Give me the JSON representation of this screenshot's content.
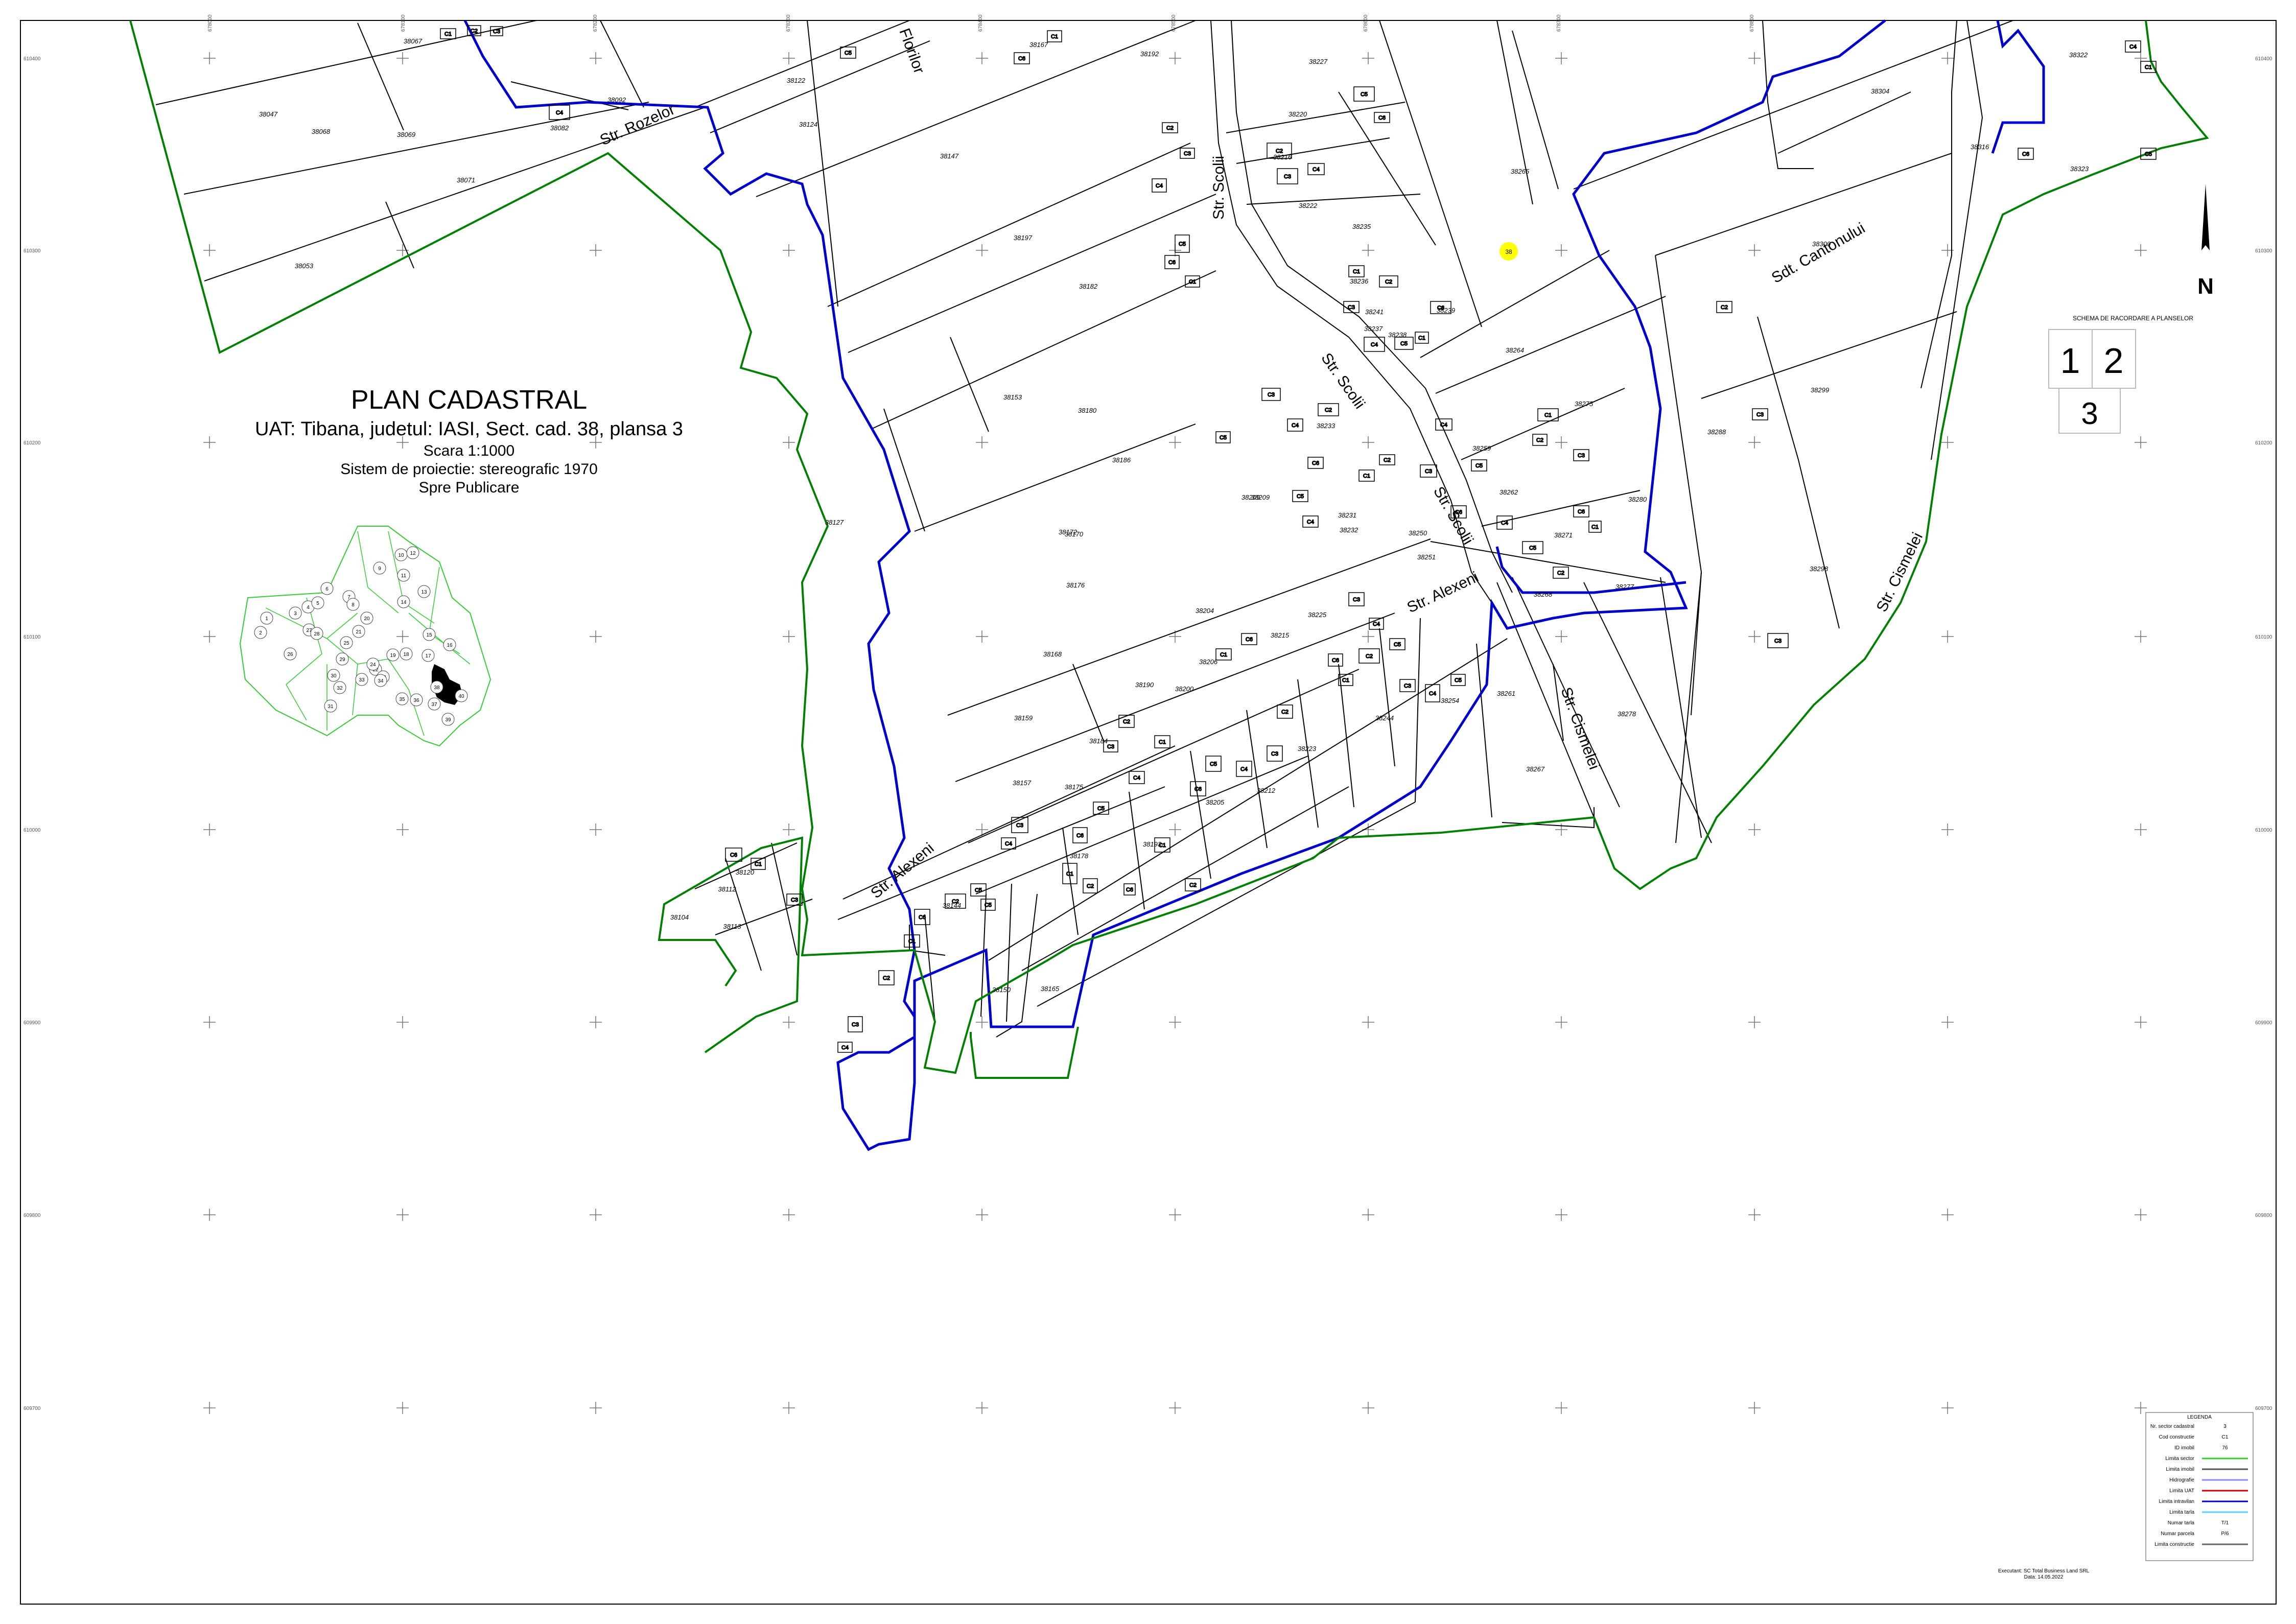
{
  "title": {
    "main": "PLAN CADASTRAL",
    "uat": "UAT: Tibana, judetul: IASI, Sect. cad. 38, plansa 3",
    "scale": "Scara 1:1000",
    "projection": "Sistem de proiectie: stereografic 1970",
    "purpose": "Spre Publicare"
  },
  "north_label": "N",
  "sector_marker": "38",
  "colors": {
    "parcel_line": "#000000",
    "intravilan": "#0000cc",
    "sector_boundary": "#008000",
    "overview_green": "#33cc33",
    "sector_marker": "#ffff00"
  },
  "streets": [
    {
      "label": "Str. Rozelor"
    },
    {
      "label": "Florilor"
    },
    {
      "label": "Str. Scolii"
    },
    {
      "label": "Str. Scolii"
    },
    {
      "label": "Str. Scolii"
    },
    {
      "label": "Str. Alexeni"
    },
    {
      "label": "Str. Alexeni"
    },
    {
      "label": "Str. Cismelei"
    },
    {
      "label": "Sdt. Cantonului"
    },
    {
      "label": "Str. Cismelei"
    }
  ],
  "parcels": [
    "38067",
    "38047",
    "38068",
    "38069",
    "38092",
    "38082",
    "38071",
    "38053",
    "38122",
    "38124",
    "38147",
    "38167",
    "38192",
    "38197",
    "38182",
    "38153",
    "38180",
    "38186",
    "38227",
    "38220",
    "38216",
    "38222",
    "38235",
    "38236",
    "38237",
    "38241",
    "38238",
    "38239",
    "38265",
    "38264",
    "38275",
    "38259",
    "38262",
    "38271",
    "38277",
    "38268",
    "38250",
    "38231",
    "38232",
    "38251",
    "38209",
    "38204",
    "38215",
    "38225",
    "38170",
    "38176",
    "38159",
    "38157",
    "38184",
    "38200",
    "38206",
    "38175",
    "38178",
    "38193",
    "38205",
    "38212",
    "38223",
    "38244",
    "38254",
    "38261",
    "38267",
    "38278",
    "38280",
    "38288",
    "38298",
    "38299",
    "38300",
    "38304",
    "38322",
    "38323",
    "38316",
    "38120",
    "38112",
    "38113",
    "38104",
    "38144",
    "38150",
    "38165",
    "38127",
    "38168",
    "38172",
    "38190",
    "38209",
    "38233"
  ],
  "construction_labels": [
    "C1",
    "C2",
    "C3",
    "C4",
    "C5",
    "C6"
  ],
  "coord_labels": {
    "left": [
      "610400",
      "610300",
      "610200",
      "610100",
      "610000",
      "609900",
      "609800",
      "609700"
    ],
    "right": [
      "610400",
      "610300",
      "610200",
      "610100",
      "610000",
      "609900",
      "609800",
      "609700"
    ],
    "top": [
      "678000",
      "678100",
      "678200",
      "678300",
      "678400",
      "678500",
      "678600",
      "678700",
      "678800"
    ]
  },
  "overview": {
    "sectors": [
      "1",
      "2",
      "3",
      "4",
      "5",
      "6",
      "7",
      "8",
      "9",
      "10",
      "11",
      "12",
      "13",
      "14",
      "15",
      "16",
      "17",
      "18",
      "19",
      "20",
      "21",
      "22",
      "23",
      "24",
      "25",
      "26",
      "27",
      "28",
      "29",
      "30",
      "31",
      "32",
      "33",
      "34",
      "35",
      "36",
      "37",
      "38",
      "39",
      "40"
    ]
  },
  "sheet_scheme": {
    "title": "SCHEMA DE RACORDARE A PLANSELOR",
    "cells": [
      "1",
      "2",
      "3"
    ]
  },
  "legend": {
    "title": "LEGENDA",
    "rows": [
      {
        "label": "Nr. sector cadastral",
        "sample": "3"
      },
      {
        "label": "Cod constructie",
        "sample": "C1"
      },
      {
        "label": "ID imobil",
        "sample": "76"
      },
      {
        "label": "Limita sector",
        "sample": ""
      },
      {
        "label": "Limita imobil",
        "sample": ""
      },
      {
        "label": "Hidrografie",
        "sample": ""
      },
      {
        "label": "Limita UAT",
        "sample": ""
      },
      {
        "label": "Limita intravilan",
        "sample": ""
      },
      {
        "label": "Limita tarla",
        "sample": ""
      },
      {
        "label": "Numar tarla",
        "sample": "T/1"
      },
      {
        "label": "Numar parcela",
        "sample": "P/6"
      },
      {
        "label": "Limita constructie",
        "sample": ""
      }
    ]
  },
  "footer": {
    "executant": "Executant: SC Total Business Land SRL",
    "date": "Data: 14.05.2022"
  }
}
